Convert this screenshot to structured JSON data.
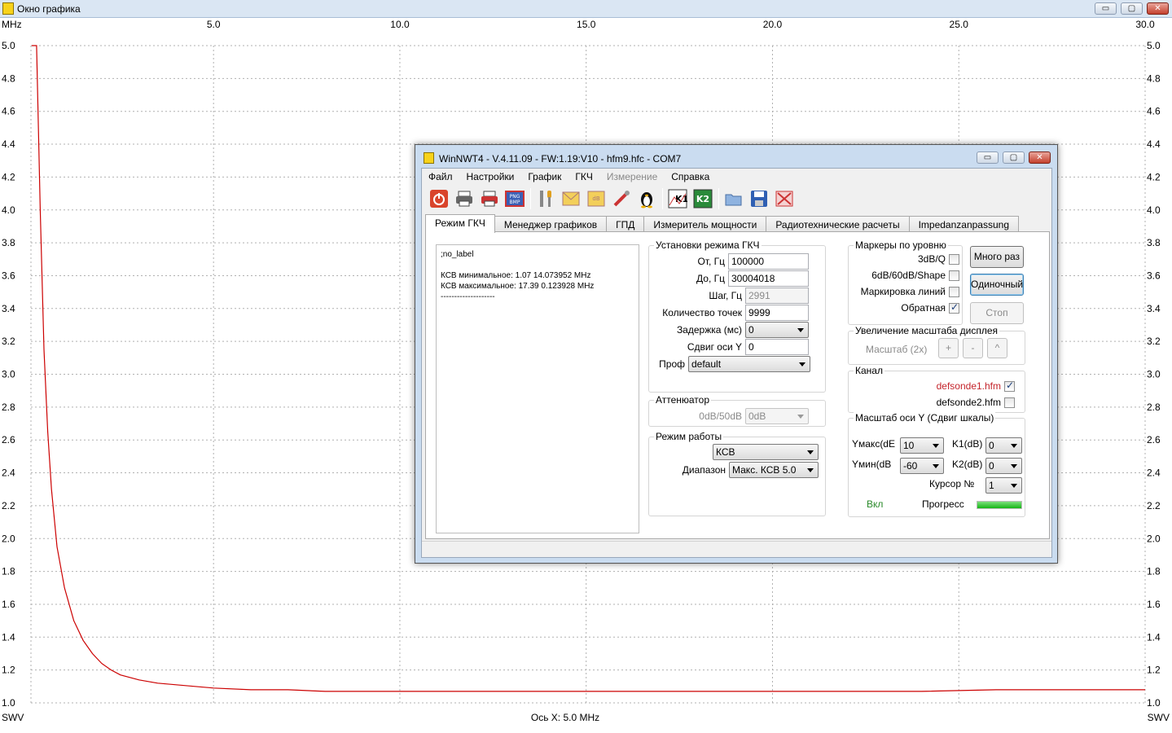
{
  "outer_window": {
    "title": "Окно графика",
    "buttons": {
      "min": "▭",
      "max": "▢",
      "close": "✕"
    }
  },
  "chart_data": {
    "type": "line",
    "x_unit_label": "MHz",
    "x_ticks": [
      5.0,
      10.0,
      15.0,
      20.0,
      25.0,
      30.0
    ],
    "x_tick_labels": [
      "5.0",
      "10.0",
      "15.0",
      "20.0",
      "25.0",
      "30.0"
    ],
    "y_ticks": [
      1.0,
      1.2,
      1.4,
      1.6,
      1.8,
      2.0,
      2.2,
      2.4,
      2.6,
      2.8,
      3.0,
      3.2,
      3.4,
      3.6,
      3.8,
      4.0,
      4.2,
      4.4,
      4.6,
      4.8,
      5.0
    ],
    "y_tick_labels": [
      "1.0",
      "1.2",
      "1.4",
      "1.6",
      "1.8",
      "2.0",
      "2.2",
      "2.4",
      "2.6",
      "2.8",
      "3.0",
      "3.2",
      "3.4",
      "3.6",
      "3.8",
      "4.0",
      "4.2",
      "4.4",
      "4.6",
      "4.8",
      "5.0"
    ],
    "xlim": [
      0.1,
      30.0
    ],
    "ylim": [
      1.0,
      5.0
    ],
    "grid": true,
    "ylabel_left": "SWV",
    "ylabel_right": "SWV",
    "x_axis_label": "Ось X: 5.0 MHz",
    "series": [
      {
        "color": "#cc0000",
        "x": [
          0.12,
          0.25,
          0.35,
          0.45,
          0.55,
          0.65,
          0.8,
          1.0,
          1.25,
          1.5,
          1.75,
          2.0,
          2.25,
          2.5,
          3.0,
          3.5,
          4.0,
          4.5,
          5.0,
          6.0,
          7.0,
          8.0,
          10.0,
          12.0,
          14.07,
          16.0,
          18.0,
          20.0,
          22.0,
          24.0,
          26.0,
          28.0,
          30.0
        ],
        "y": [
          5.0,
          5.0,
          4.0,
          3.15,
          2.65,
          2.3,
          1.95,
          1.7,
          1.5,
          1.38,
          1.3,
          1.24,
          1.2,
          1.17,
          1.14,
          1.12,
          1.11,
          1.1,
          1.09,
          1.08,
          1.08,
          1.07,
          1.07,
          1.07,
          1.07,
          1.07,
          1.07,
          1.07,
          1.07,
          1.07,
          1.08,
          1.08,
          1.08
        ]
      }
    ]
  },
  "dialog": {
    "title": "WinNWT4 - V.4.11.09 - FW:1.19:V10 - hfm9.hfc - COM7",
    "buttons": {
      "min": "▭",
      "max": "▢",
      "close": "✕"
    },
    "menu": [
      "Файл",
      "Настройки",
      "График",
      "ГКЧ",
      "Измерение",
      "Справка"
    ],
    "toolbar_icons": [
      "power-icon",
      "print-icon",
      "print-color-icon",
      "export-image-icon",
      "tools-icon",
      "envelope-icon",
      "db-icon",
      "wrench-icon",
      "linux-icon",
      "k1-graph-icon",
      "k2-graph-icon",
      "open-folder-icon",
      "save-icon",
      "close-file-icon"
    ],
    "tabs": [
      "Режим ГКЧ",
      "Менеджер графиков",
      "ГПД",
      "Измеритель мощности",
      "Радиотехнические расчеты",
      "Impedanzanpassung"
    ],
    "info_text": {
      "line1": ";no_label",
      "line2": "КСВ минимальное: 1.07  14.073952 MHz",
      "line3": "КСВ максимальное: 17.39  0.123928 MHz",
      "line4": "--------------------"
    },
    "sweep": {
      "title": "Установки режима ГКЧ",
      "from_label": "От, Гц",
      "from_value": "100000",
      "to_label": "До, Гц",
      "to_value": "30004018",
      "step_label": "Шаг, Гц",
      "step_value": "2991",
      "points_label": "Количество точек",
      "points_value": "9999",
      "delay_label": "Задержка (мс)",
      "delay_value": "0",
      "yshift_label": "Сдвиг оси Y",
      "yshift_value": "0",
      "profile_label": "Проф",
      "profile_value": "default"
    },
    "attenuator": {
      "title": "Аттенюатор",
      "label": "0dB/50dB",
      "value": "0dB"
    },
    "mode": {
      "title": "Режим работы",
      "mode_value": "КСВ",
      "range_label": "Диапазон",
      "range_value": "Макс. КСВ 5.0"
    },
    "markers": {
      "title": "Маркеры по уровню",
      "items": [
        {
          "label": "3dB/Q",
          "checked": false
        },
        {
          "label": "6dB/60dB/Shape",
          "checked": false
        },
        {
          "label": "Маркировка линий",
          "checked": false
        },
        {
          "label": "Обратная",
          "checked": true
        }
      ]
    },
    "actions": {
      "many": "Много раз",
      "single": "Одиночный",
      "stop": "Стоп"
    },
    "zoom": {
      "title": "Увеличение масштаба дисплея",
      "label": "Масштаб (2x)",
      "plus": "+",
      "minus": "-",
      "up": "^"
    },
    "channel": {
      "title": "Канал",
      "ch1_label": "defsonde1.hfm",
      "ch1_checked": true,
      "ch2_label": "defsonde2.hfm",
      "ch2_checked": false
    },
    "yscale": {
      "title": "Масштаб оси Y (Сдвиг шкалы)",
      "ymax_label": "Yмакс(dE",
      "ymax_value": "10",
      "ymin_label": "Yмин(dB",
      "ymin_value": "-60",
      "k1_label": "K1(dB)",
      "k1_value": "0",
      "k2_label": "K2(dB)",
      "k2_value": "0",
      "cursor_label": "Курсор №",
      "cursor_value": "1",
      "on_label": "Вкл",
      "progress_label": "Прогресс",
      "progress": 1.0
    }
  }
}
